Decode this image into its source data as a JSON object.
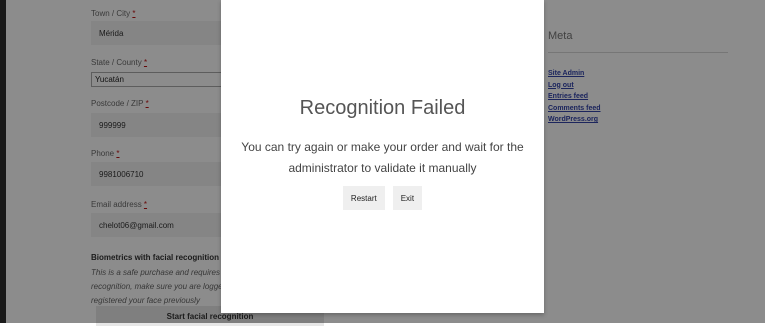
{
  "form": {
    "town": {
      "label": "Town / City",
      "value": "Mérida"
    },
    "state": {
      "label": "State / County",
      "value": "Yucatán"
    },
    "postcode": {
      "label": "Postcode / ZIP",
      "value": "999999"
    },
    "phone": {
      "label": "Phone",
      "value": "9981006710"
    },
    "email": {
      "label": "Email address",
      "value": "chelot06@gmail.com"
    },
    "required_mark": "*",
    "biometrics": {
      "title": "Biometrics with facial recognition",
      "lines": [
        "This is a safe purchase and requires y",
        "recognition, make sure you are logge",
        "registered your face previously"
      ],
      "start_button": "Start facial recognition"
    }
  },
  "sidebar": {
    "title": "Meta",
    "links": [
      "Site Admin",
      "Log out",
      "Entries feed",
      "Comments feed",
      "WordPress.org"
    ]
  },
  "modal": {
    "title": "Recognition Failed",
    "message": "You can try again or make your order and wait for the administrator to validate it manually",
    "restart_label": "Restart",
    "exit_label": "Exit"
  }
}
